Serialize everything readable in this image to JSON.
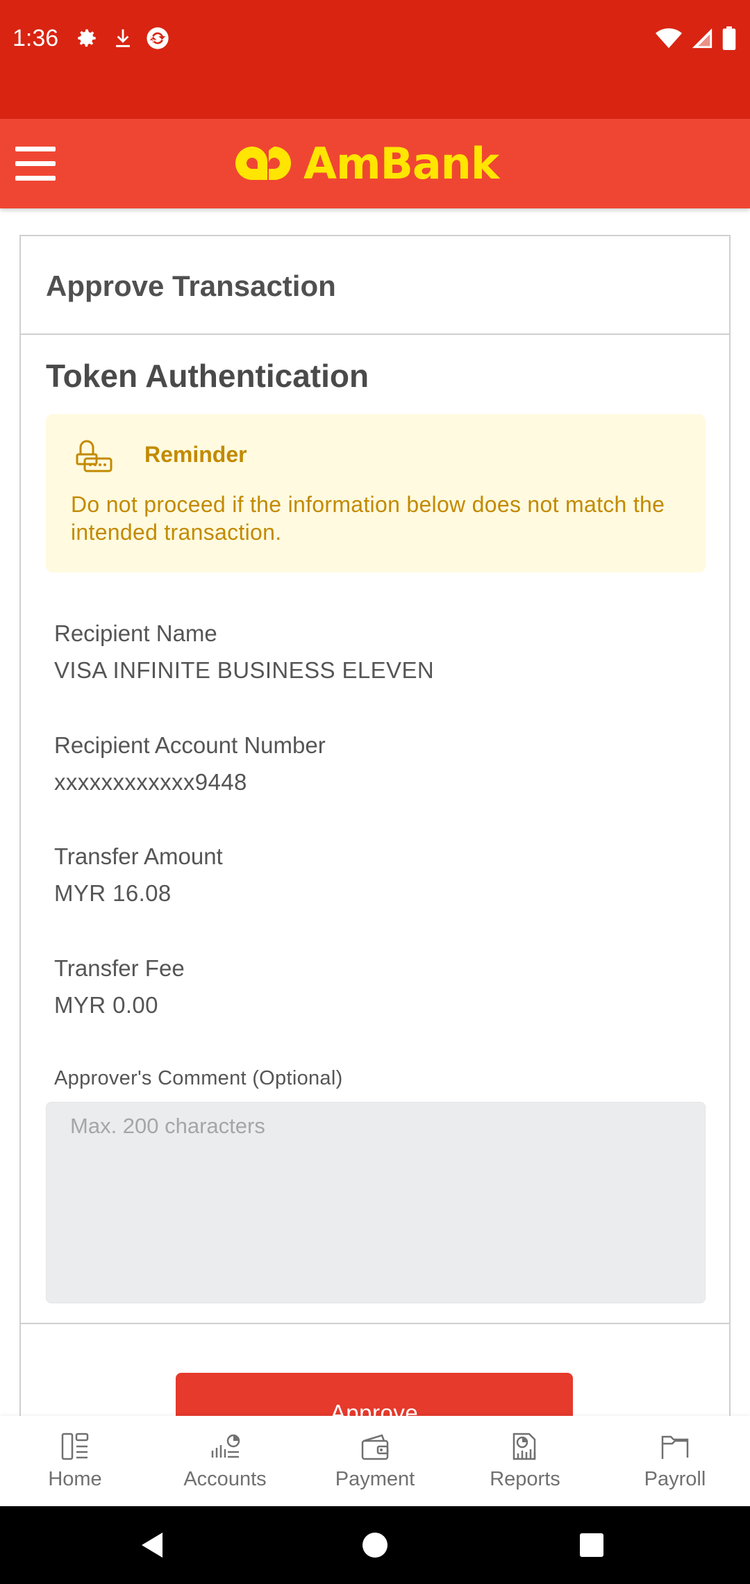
{
  "status_bar": {
    "time": "1:36",
    "icons_left": [
      "gear-icon",
      "download-icon",
      "sync-icon"
    ],
    "icons_right": [
      "wifi-icon",
      "signal-icon",
      "battery-icon"
    ]
  },
  "header": {
    "brand_name": "AmBank",
    "brand_color": "#ffe500",
    "header_color": "#ef4633",
    "menu_icon": "hamburger-menu-icon"
  },
  "page": {
    "title": "Approve Transaction",
    "section_title": "Token Authentication"
  },
  "reminder": {
    "icon": "token-lock-icon",
    "title": "Reminder",
    "text": "Do not proceed if the information below does not match the intended transaction."
  },
  "details": [
    {
      "label": "Recipient Name",
      "value": "VISA INFINITE BUSINESS ELEVEN"
    },
    {
      "label": "Recipient Account Number",
      "value": "xxxxxxxxxxxx9448"
    },
    {
      "label": "Transfer Amount",
      "value": "MYR 16.08"
    },
    {
      "label": "Transfer Fee",
      "value": "MYR 0.00"
    }
  ],
  "comment": {
    "label": "Approver's Comment (Optional)",
    "placeholder": "Max. 200 characters",
    "value": ""
  },
  "actions": {
    "approve_label": "Approve",
    "approve_color": "#e53a2c"
  },
  "bottom_nav": [
    {
      "label": "Home",
      "icon": "home-icon"
    },
    {
      "label": "Accounts",
      "icon": "accounts-icon"
    },
    {
      "label": "Payment",
      "icon": "wallet-icon"
    },
    {
      "label": "Reports",
      "icon": "reports-icon"
    },
    {
      "label": "Payroll",
      "icon": "payroll-icon"
    }
  ],
  "system_nav": [
    "back-icon",
    "home-circle-icon",
    "recents-icon"
  ]
}
